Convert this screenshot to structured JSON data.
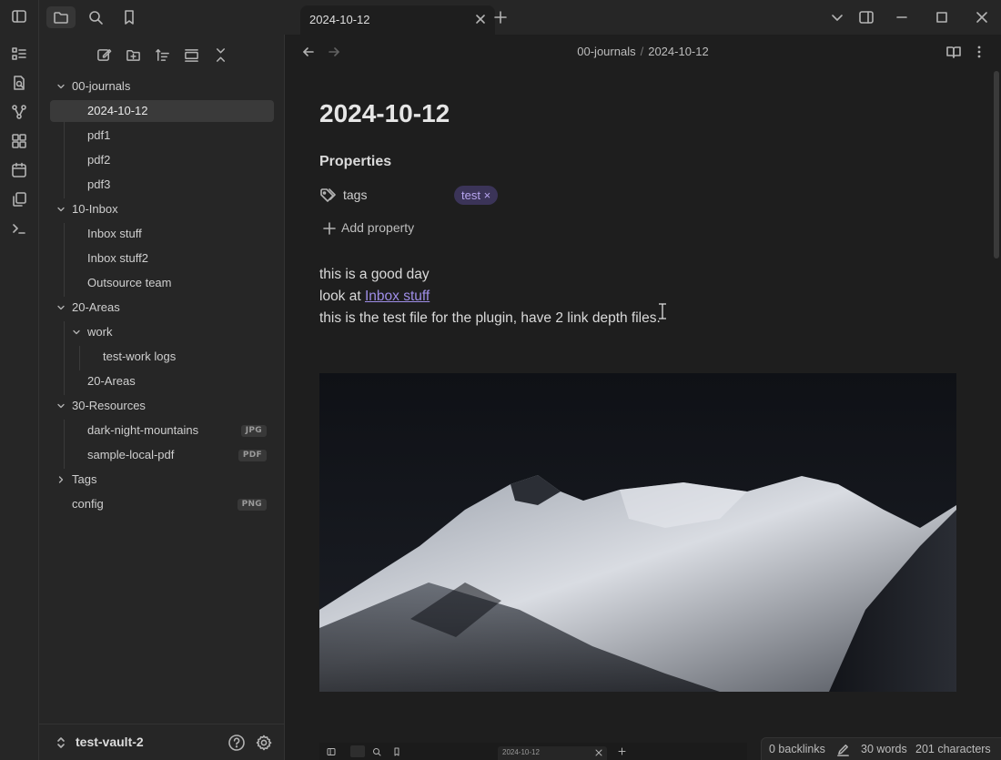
{
  "sidebar": {
    "tree": [
      {
        "label": "00-journals",
        "type": "folder",
        "expanded": true
      },
      {
        "label": "2024-10-12",
        "type": "file",
        "selected": true
      },
      {
        "label": "pdf1",
        "type": "file"
      },
      {
        "label": "pdf2",
        "type": "file"
      },
      {
        "label": "pdf3",
        "type": "file"
      },
      {
        "label": "10-Inbox",
        "type": "folder",
        "expanded": true
      },
      {
        "label": "Inbox stuff",
        "type": "file"
      },
      {
        "label": "Inbox stuff2",
        "type": "file"
      },
      {
        "label": "Outsource team",
        "type": "file"
      },
      {
        "label": "20-Areas",
        "type": "folder",
        "expanded": true
      },
      {
        "label": "work",
        "type": "folder",
        "expanded": true
      },
      {
        "label": "test-work logs",
        "type": "file"
      },
      {
        "label": "20-Areas",
        "type": "file"
      },
      {
        "label": "30-Resources",
        "type": "folder",
        "expanded": true
      },
      {
        "label": "dark-night-mountains",
        "type": "file",
        "badge": "JPG"
      },
      {
        "label": "sample-local-pdf",
        "type": "file",
        "badge": "PDF"
      },
      {
        "label": "Tags",
        "type": "folder",
        "expanded": false
      },
      {
        "label": "config",
        "type": "file",
        "badge": "PNG"
      }
    ],
    "vault_name": "test-vault-2"
  },
  "tabs": {
    "active_title": "2024-10-12"
  },
  "header": {
    "breadcrumb_folder": "00-journals",
    "breadcrumb_sep": "/",
    "breadcrumb_file": "2024-10-12"
  },
  "note": {
    "title": "2024-10-12",
    "properties_heading": "Properties",
    "property_key": "tags",
    "property_tag": "test",
    "tag_remove_glyph": "×",
    "add_property_label": "Add property",
    "line1": "this is a good day",
    "line2_prefix": "look at ",
    "line2_link": "Inbox stuff",
    "line3": "this is the test file for the plugin, have 2 link depth files.",
    "mini_tab_title": "2024-10-12"
  },
  "status": {
    "backlinks": "0 backlinks",
    "words": "30 words",
    "characters": "201 characters"
  },
  "colors": {
    "background": "#1e1e1e",
    "sidebar": "#262626",
    "accent": "#9f8ee8",
    "tag_bg": "#3b3458"
  }
}
